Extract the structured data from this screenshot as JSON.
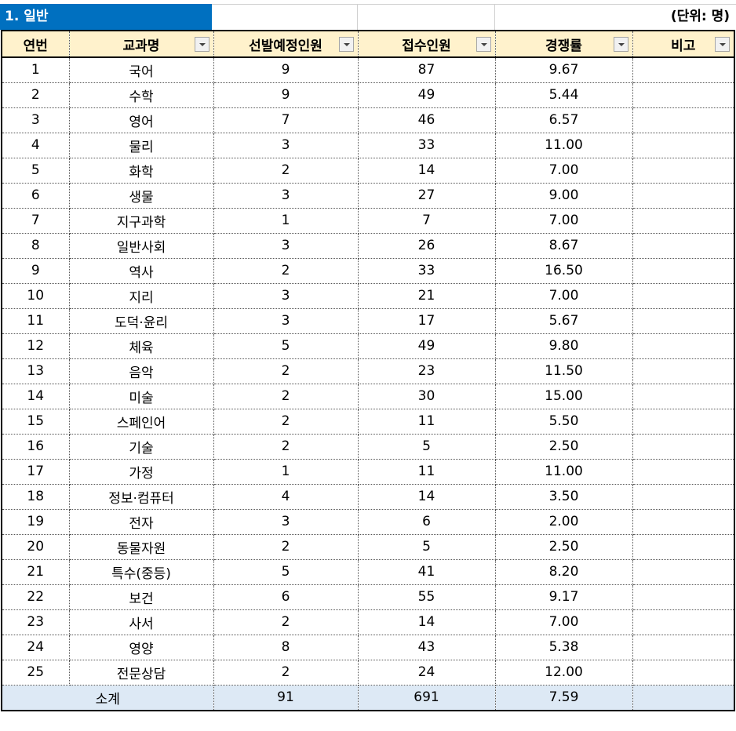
{
  "section": {
    "title": "1. 일반",
    "unit": "(단위: 명)"
  },
  "headers": [
    "연번",
    "교과명",
    "선발예정인원",
    "접수인원",
    "경쟁률",
    "비고"
  ],
  "rows": [
    [
      "1",
      "국어",
      "9",
      "87",
      "9.67",
      ""
    ],
    [
      "2",
      "수학",
      "9",
      "49",
      "5.44",
      ""
    ],
    [
      "3",
      "영어",
      "7",
      "46",
      "6.57",
      ""
    ],
    [
      "4",
      "물리",
      "3",
      "33",
      "11.00",
      ""
    ],
    [
      "5",
      "화학",
      "2",
      "14",
      "7.00",
      ""
    ],
    [
      "6",
      "생물",
      "3",
      "27",
      "9.00",
      ""
    ],
    [
      "7",
      "지구과학",
      "1",
      "7",
      "7.00",
      ""
    ],
    [
      "8",
      "일반사회",
      "3",
      "26",
      "8.67",
      ""
    ],
    [
      "9",
      "역사",
      "2",
      "33",
      "16.50",
      ""
    ],
    [
      "10",
      "지리",
      "3",
      "21",
      "7.00",
      ""
    ],
    [
      "11",
      "도덕·윤리",
      "3",
      "17",
      "5.67",
      ""
    ],
    [
      "12",
      "체육",
      "5",
      "49",
      "9.80",
      ""
    ],
    [
      "13",
      "음악",
      "2",
      "23",
      "11.50",
      ""
    ],
    [
      "14",
      "미술",
      "2",
      "30",
      "15.00",
      ""
    ],
    [
      "15",
      "스페인어",
      "2",
      "11",
      "5.50",
      ""
    ],
    [
      "16",
      "기술",
      "2",
      "5",
      "2.50",
      ""
    ],
    [
      "17",
      "가정",
      "1",
      "11",
      "11.00",
      ""
    ],
    [
      "18",
      "정보·컴퓨터",
      "4",
      "14",
      "3.50",
      ""
    ],
    [
      "19",
      "전자",
      "3",
      "6",
      "2.00",
      ""
    ],
    [
      "20",
      "동물자원",
      "2",
      "5",
      "2.50",
      ""
    ],
    [
      "21",
      "특수(중등)",
      "5",
      "41",
      "8.20",
      ""
    ],
    [
      "22",
      "보건",
      "6",
      "55",
      "9.17",
      ""
    ],
    [
      "23",
      "사서",
      "2",
      "14",
      "7.00",
      ""
    ],
    [
      "24",
      "영양",
      "8",
      "43",
      "5.38",
      ""
    ],
    [
      "25",
      "전문상담",
      "2",
      "24",
      "12.00",
      ""
    ]
  ],
  "total": {
    "label": "소계",
    "planned": "91",
    "applicants": "691",
    "ratio": "7.59",
    "note": ""
  },
  "colors": {
    "title_bg": "#0070c0",
    "header_bg": "#fff2cc",
    "total_bg": "#dde9f5"
  }
}
